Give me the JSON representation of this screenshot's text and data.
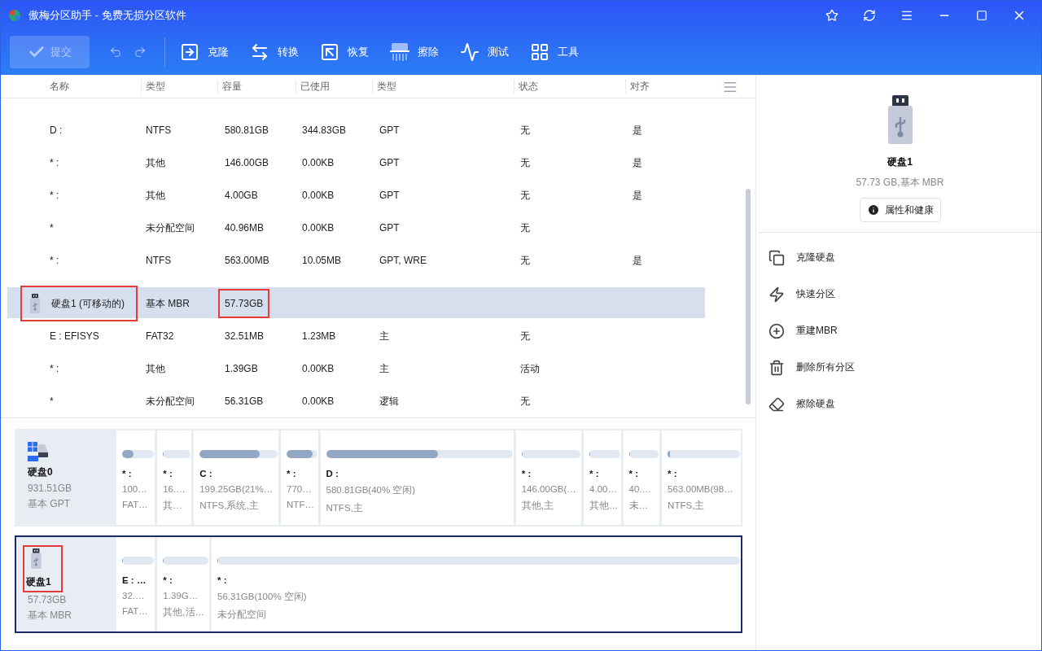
{
  "window": {
    "title": "傲梅分区助手 - 免费无损分区软件"
  },
  "toolbar": {
    "submit": {
      "label": "提交",
      "disabled": true
    },
    "tools": [
      {
        "kind": "clone",
        "label": "克隆"
      },
      {
        "kind": "convert",
        "label": "转换"
      },
      {
        "kind": "recover",
        "label": "恢复"
      },
      {
        "kind": "wipe",
        "label": "擦除"
      },
      {
        "kind": "test",
        "label": "测试"
      },
      {
        "kind": "tools",
        "label": "工具"
      }
    ]
  },
  "table": {
    "columns": [
      "名称",
      "类型",
      "容量",
      "已使用",
      "类型",
      "状态",
      "对齐"
    ],
    "rows": [
      {
        "kind": "partition",
        "selected": false,
        "cells": [
          "D :",
          "NTFS",
          "580.81GB",
          "344.83GB",
          "GPT",
          "无",
          "是"
        ]
      },
      {
        "kind": "partition",
        "selected": false,
        "cells": [
          "* :",
          "其他",
          "146.00GB",
          "0.00KB",
          "GPT",
          "无",
          "是"
        ]
      },
      {
        "kind": "partition",
        "selected": false,
        "cells": [
          "* :",
          "其他",
          "4.00GB",
          "0.00KB",
          "GPT",
          "无",
          "是"
        ]
      },
      {
        "kind": "partition",
        "selected": false,
        "cells": [
          "*",
          "未分配空间",
          "40.96MB",
          "0.00KB",
          "GPT",
          "无"
        ]
      },
      {
        "kind": "partition",
        "selected": false,
        "cells": [
          "* :",
          "NTFS",
          "563.00MB",
          "10.05MB",
          "GPT, WRE",
          "无",
          "是"
        ]
      },
      {
        "kind": "disk",
        "selected": true,
        "cells": [
          {
            "text": "硬盘1 (可移动的)",
            "highlighted": true
          },
          {
            "text": "基本 MBR",
            "highlighted": false
          },
          {
            "text": "57.73GB",
            "highlighted": true
          }
        ]
      },
      {
        "kind": "partition",
        "selected": false,
        "cells": [
          "E : EFISYS",
          "FAT32",
          "32.51MB",
          "1.23MB",
          "主",
          "无"
        ]
      },
      {
        "kind": "partition",
        "selected": false,
        "cells": [
          "* :",
          "其他",
          "1.39GB",
          "0.00KB",
          "主",
          "活动"
        ]
      },
      {
        "kind": "partition",
        "selected": false,
        "cells": [
          "*",
          "未分配空间",
          "56.31GB",
          "0.00KB",
          "逻辑",
          "无"
        ]
      }
    ]
  },
  "disk_map": [
    {
      "kind": "ssd",
      "name": "硬盘0",
      "size": "931.51GB",
      "type": "基本 GPT",
      "selected": false,
      "highlighted": false,
      "partitions": [
        {
          "label": "* :",
          "detail": "100…",
          "fs": "FAT…",
          "level": 0.35
        },
        {
          "label": "* :",
          "detail": "16.…",
          "fs": "其…",
          "level": 0
        },
        {
          "label": "C :",
          "detail": "199.25GB(21%…",
          "fs": "NTFS,系统,主",
          "level": 0.77
        },
        {
          "label": "* :",
          "detail": "770…",
          "fs": "NTF…",
          "level": 0.85
        },
        {
          "label": "D :",
          "detail": "580.81GB(40% 空闲)",
          "fs": "NTFS,主",
          "level": 0.6
        },
        {
          "label": "* :",
          "detail": "146.00GB(…",
          "fs": "其他,主",
          "level": 0
        },
        {
          "label": "* :",
          "detail": "4.00…",
          "fs": "其他…",
          "level": 0
        },
        {
          "label": "* :",
          "detail": "40.…",
          "fs": "未…",
          "level": 0
        },
        {
          "label": "* :",
          "detail": "563.00MB(98…",
          "fs": "NTFS,主",
          "level": 0.03
        }
      ]
    },
    {
      "kind": "usb",
      "name": "硬盘1",
      "size": "57.73GB",
      "type": "基本 MBR",
      "selected": true,
      "highlighted": true,
      "partitions": [
        {
          "label": "E : …",
          "detail": "32.…",
          "fs": "FAT…",
          "level": 0
        },
        {
          "label": "* :",
          "detail": "1.39G…",
          "fs": "其他,活…",
          "level": 0
        },
        {
          "label": "* :",
          "detail": "56.31GB(100% 空闲)",
          "fs": "未分配空间",
          "level": 0
        }
      ]
    }
  ],
  "side_panel": {
    "disk_name": "硬盘1",
    "disk_info": "57.73 GB,基本 MBR",
    "properties_button": "属性和健康",
    "actions": [
      {
        "kind": "clone",
        "label": "克隆硬盘"
      },
      {
        "kind": "quick",
        "label": "快速分区"
      },
      {
        "kind": "rebuild",
        "label": "重建MBR"
      },
      {
        "kind": "delete",
        "label": "删除所有分区"
      },
      {
        "kind": "wipe",
        "label": "擦除硬盘"
      }
    ]
  }
}
